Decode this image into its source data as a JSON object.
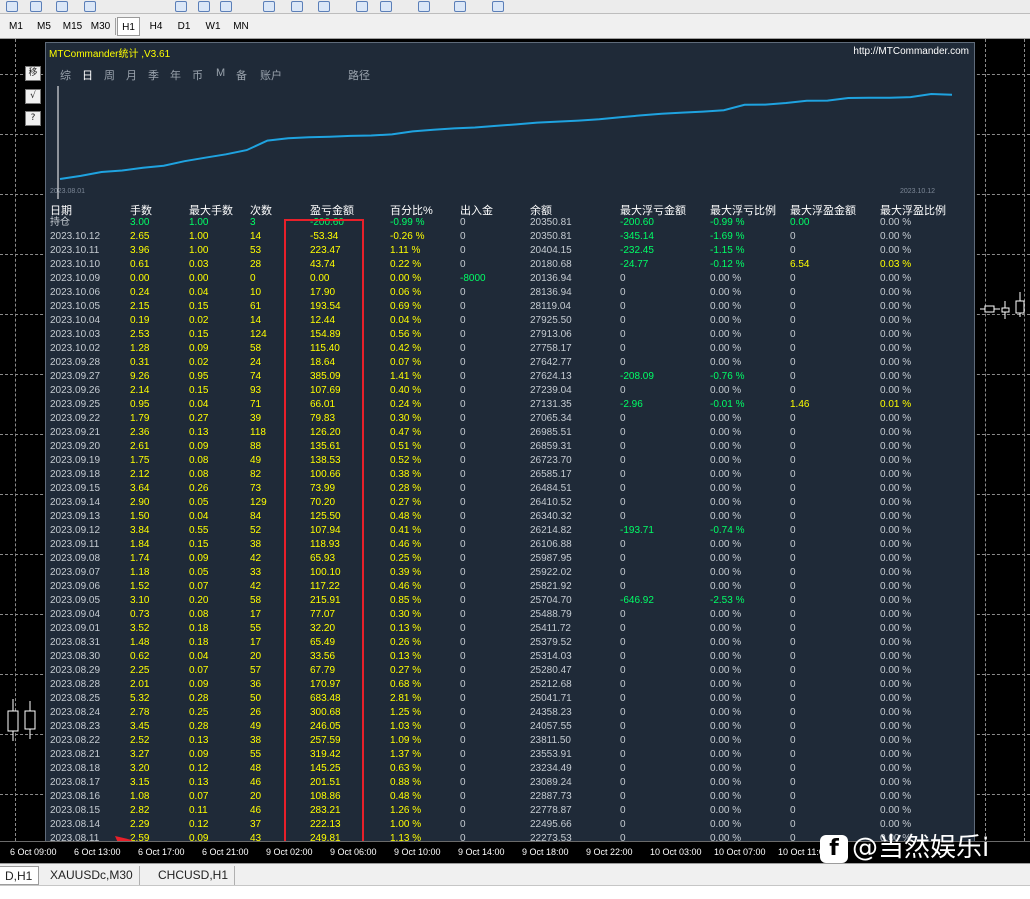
{
  "timeframes": [
    "M1",
    "M5",
    "M15",
    "M30",
    "H1",
    "H4",
    "D1",
    "W1",
    "MN"
  ],
  "active_timeframe": "H1",
  "side_buttons": [
    "移",
    "√",
    "?"
  ],
  "panel": {
    "title": "MTCommander统计 ,V3.61",
    "url": "http://MTCommander.com",
    "tabs": [
      "综",
      "日",
      "周",
      "月",
      "季",
      "年",
      "币",
      "M",
      "备",
      "账户",
      "路径"
    ],
    "active_tab": "日",
    "equity_start_date": "2023.08.01",
    "equity_end_date": "2023.10.12"
  },
  "table": {
    "headers": [
      "日期",
      "手数",
      "最大手数",
      "次数",
      "盈亏金额",
      "百分比%",
      "出入金",
      "余额",
      "最大浮亏金额",
      "最大浮亏比例",
      "最大浮盈金额",
      "最大浮盈比例"
    ],
    "rows": [
      [
        "持仓",
        "3.00",
        "1.00",
        "3",
        "-200.60",
        "-0.99 %",
        "0",
        "20350.81",
        "-200.60",
        "-0.99 %",
        "0.00",
        "0.00 %"
      ],
      [
        "2023.10.12",
        "2.65",
        "1.00",
        "14",
        "-53.34",
        "-0.26 %",
        "0",
        "20350.81",
        "-345.14",
        "-1.69 %",
        "0",
        "0.00 %"
      ],
      [
        "2023.10.11",
        "3.96",
        "1.00",
        "53",
        "223.47",
        "1.11 %",
        "0",
        "20404.15",
        "-232.45",
        "-1.15 %",
        "0",
        "0.00 %"
      ],
      [
        "2023.10.10",
        "0.61",
        "0.03",
        "28",
        "43.74",
        "0.22 %",
        "0",
        "20180.68",
        "-24.77",
        "-0.12 %",
        "6.54",
        "0.03 %"
      ],
      [
        "2023.10.09",
        "0.00",
        "0.00",
        "0",
        "0.00",
        "0.00 %",
        "-8000",
        "20136.94",
        "0",
        "0.00 %",
        "0",
        "0.00 %"
      ],
      [
        "2023.10.06",
        "0.24",
        "0.04",
        "10",
        "17.90",
        "0.06 %",
        "0",
        "28136.94",
        "0",
        "0.00 %",
        "0",
        "0.00 %"
      ],
      [
        "2023.10.05",
        "2.15",
        "0.15",
        "61",
        "193.54",
        "0.69 %",
        "0",
        "28119.04",
        "0",
        "0.00 %",
        "0",
        "0.00 %"
      ],
      [
        "2023.10.04",
        "0.19",
        "0.02",
        "14",
        "12.44",
        "0.04 %",
        "0",
        "27925.50",
        "0",
        "0.00 %",
        "0",
        "0.00 %"
      ],
      [
        "2023.10.03",
        "2.53",
        "0.15",
        "124",
        "154.89",
        "0.56 %",
        "0",
        "27913.06",
        "0",
        "0.00 %",
        "0",
        "0.00 %"
      ],
      [
        "2023.10.02",
        "1.28",
        "0.09",
        "58",
        "115.40",
        "0.42 %",
        "0",
        "27758.17",
        "0",
        "0.00 %",
        "0",
        "0.00 %"
      ],
      [
        "2023.09.28",
        "0.31",
        "0.02",
        "24",
        "18.64",
        "0.07 %",
        "0",
        "27642.77",
        "0",
        "0.00 %",
        "0",
        "0.00 %"
      ],
      [
        "2023.09.27",
        "9.26",
        "0.95",
        "74",
        "385.09",
        "1.41 %",
        "0",
        "27624.13",
        "-208.09",
        "-0.76 %",
        "0",
        "0.00 %"
      ],
      [
        "2023.09.26",
        "2.14",
        "0.15",
        "93",
        "107.69",
        "0.40 %",
        "0",
        "27239.04",
        "0",
        "0.00 %",
        "0",
        "0.00 %"
      ],
      [
        "2023.09.25",
        "0.95",
        "0.04",
        "71",
        "66.01",
        "0.24 %",
        "0",
        "27131.35",
        "-2.96",
        "-0.01 %",
        "1.46",
        "0.01 %"
      ],
      [
        "2023.09.22",
        "1.79",
        "0.27",
        "39",
        "79.83",
        "0.30 %",
        "0",
        "27065.34",
        "0",
        "0.00 %",
        "0",
        "0.00 %"
      ],
      [
        "2023.09.21",
        "2.36",
        "0.13",
        "118",
        "126.20",
        "0.47 %",
        "0",
        "26985.51",
        "0",
        "0.00 %",
        "0",
        "0.00 %"
      ],
      [
        "2023.09.20",
        "2.61",
        "0.09",
        "88",
        "135.61",
        "0.51 %",
        "0",
        "26859.31",
        "0",
        "0.00 %",
        "0",
        "0.00 %"
      ],
      [
        "2023.09.19",
        "1.75",
        "0.08",
        "49",
        "138.53",
        "0.52 %",
        "0",
        "26723.70",
        "0",
        "0.00 %",
        "0",
        "0.00 %"
      ],
      [
        "2023.09.18",
        "2.12",
        "0.08",
        "82",
        "100.66",
        "0.38 %",
        "0",
        "26585.17",
        "0",
        "0.00 %",
        "0",
        "0.00 %"
      ],
      [
        "2023.09.15",
        "3.64",
        "0.26",
        "73",
        "73.99",
        "0.28 %",
        "0",
        "26484.51",
        "0",
        "0.00 %",
        "0",
        "0.00 %"
      ],
      [
        "2023.09.14",
        "2.90",
        "0.05",
        "129",
        "70.20",
        "0.27 %",
        "0",
        "26410.52",
        "0",
        "0.00 %",
        "0",
        "0.00 %"
      ],
      [
        "2023.09.13",
        "1.50",
        "0.04",
        "84",
        "125.50",
        "0.48 %",
        "0",
        "26340.32",
        "0",
        "0.00 %",
        "0",
        "0.00 %"
      ],
      [
        "2023.09.12",
        "3.84",
        "0.55",
        "52",
        "107.94",
        "0.41 %",
        "0",
        "26214.82",
        "-193.71",
        "-0.74 %",
        "0",
        "0.00 %"
      ],
      [
        "2023.09.11",
        "1.84",
        "0.15",
        "38",
        "118.93",
        "0.46 %",
        "0",
        "26106.88",
        "0",
        "0.00 %",
        "0",
        "0.00 %"
      ],
      [
        "2023.09.08",
        "1.74",
        "0.09",
        "42",
        "65.93",
        "0.25 %",
        "0",
        "25987.95",
        "0",
        "0.00 %",
        "0",
        "0.00 %"
      ],
      [
        "2023.09.07",
        "1.18",
        "0.05",
        "33",
        "100.10",
        "0.39 %",
        "0",
        "25922.02",
        "0",
        "0.00 %",
        "0",
        "0.00 %"
      ],
      [
        "2023.09.06",
        "1.52",
        "0.07",
        "42",
        "117.22",
        "0.46 %",
        "0",
        "25821.92",
        "0",
        "0.00 %",
        "0",
        "0.00 %"
      ],
      [
        "2023.09.05",
        "3.10",
        "0.20",
        "58",
        "215.91",
        "0.85 %",
        "0",
        "25704.70",
        "-646.92",
        "-2.53 %",
        "0",
        "0.00 %"
      ],
      [
        "2023.09.04",
        "0.73",
        "0.08",
        "17",
        "77.07",
        "0.30 %",
        "0",
        "25488.79",
        "0",
        "0.00 %",
        "0",
        "0.00 %"
      ],
      [
        "2023.09.01",
        "3.52",
        "0.18",
        "55",
        "32.20",
        "0.13 %",
        "0",
        "25411.72",
        "0",
        "0.00 %",
        "0",
        "0.00 %"
      ],
      [
        "2023.08.31",
        "1.48",
        "0.18",
        "17",
        "65.49",
        "0.26 %",
        "0",
        "25379.52",
        "0",
        "0.00 %",
        "0",
        "0.00 %"
      ],
      [
        "2023.08.30",
        "0.62",
        "0.04",
        "20",
        "33.56",
        "0.13 %",
        "0",
        "25314.03",
        "0",
        "0.00 %",
        "0",
        "0.00 %"
      ],
      [
        "2023.08.29",
        "2.25",
        "0.07",
        "57",
        "67.79",
        "0.27 %",
        "0",
        "25280.47",
        "0",
        "0.00 %",
        "0",
        "0.00 %"
      ],
      [
        "2023.08.28",
        "2.01",
        "0.09",
        "36",
        "170.97",
        "0.68 %",
        "0",
        "25212.68",
        "0",
        "0.00 %",
        "0",
        "0.00 %"
      ],
      [
        "2023.08.25",
        "5.32",
        "0.28",
        "50",
        "683.48",
        "2.81 %",
        "0",
        "25041.71",
        "0",
        "0.00 %",
        "0",
        "0.00 %"
      ],
      [
        "2023.08.24",
        "2.78",
        "0.25",
        "26",
        "300.68",
        "1.25 %",
        "0",
        "24358.23",
        "0",
        "0.00 %",
        "0",
        "0.00 %"
      ],
      [
        "2023.08.23",
        "3.45",
        "0.28",
        "49",
        "246.05",
        "1.03 %",
        "0",
        "24057.55",
        "0",
        "0.00 %",
        "0",
        "0.00 %"
      ],
      [
        "2023.08.22",
        "2.52",
        "0.13",
        "38",
        "257.59",
        "1.09 %",
        "0",
        "23811.50",
        "0",
        "0.00 %",
        "0",
        "0.00 %"
      ],
      [
        "2023.08.21",
        "3.27",
        "0.09",
        "55",
        "319.42",
        "1.37 %",
        "0",
        "23553.91",
        "0",
        "0.00 %",
        "0",
        "0.00 %"
      ],
      [
        "2023.08.18",
        "3.20",
        "0.12",
        "48",
        "145.25",
        "0.63 %",
        "0",
        "23234.49",
        "0",
        "0.00 %",
        "0",
        "0.00 %"
      ],
      [
        "2023.08.17",
        "3.15",
        "0.13",
        "46",
        "201.51",
        "0.88 %",
        "0",
        "23089.24",
        "0",
        "0.00 %",
        "0",
        "0.00 %"
      ],
      [
        "2023.08.16",
        "1.08",
        "0.07",
        "20",
        "108.86",
        "0.48 %",
        "0",
        "22887.73",
        "0",
        "0.00 %",
        "0",
        "0.00 %"
      ],
      [
        "2023.08.15",
        "2.82",
        "0.11",
        "46",
        "283.21",
        "1.26 %",
        "0",
        "22778.87",
        "0",
        "0.00 %",
        "0",
        "0.00 %"
      ],
      [
        "2023.08.14",
        "2.29",
        "0.12",
        "37",
        "222.13",
        "1.00 %",
        "0",
        "22495.66",
        "0",
        "0.00 %",
        "0",
        "0.00 %"
      ],
      [
        "2023.08.11",
        "2.59",
        "0.09",
        "43",
        "249.81",
        "1.13 %",
        "0",
        "22273.53",
        "0",
        "0.00 %",
        "0",
        "0.00 %"
      ]
    ]
  },
  "time_axis": [
    "6 Oct 09:00",
    "6 Oct 13:00",
    "6 Oct 17:00",
    "6 Oct 21:00",
    "9 Oct 02:00",
    "9 Oct 06:00",
    "9 Oct 10:00",
    "9 Oct 14:00",
    "9 Oct 18:00",
    "9 Oct 22:00",
    "10 Oct 03:00",
    "10 Oct 07:00",
    "10 Oct 11:00"
  ],
  "chart_tabs": [
    "D,H1",
    "XAUUSDc,M30",
    "CHCUSD,H1"
  ],
  "active_chart_tab": "D,H1",
  "watermark": "@当然娱乐i",
  "watermark_icon": "f",
  "colors": {
    "text": "#c5cbd1",
    "profit": "#ffff00",
    "drawdown": "#00ff66",
    "curve": "#1fa3e0",
    "highlight": "#e8202a"
  }
}
